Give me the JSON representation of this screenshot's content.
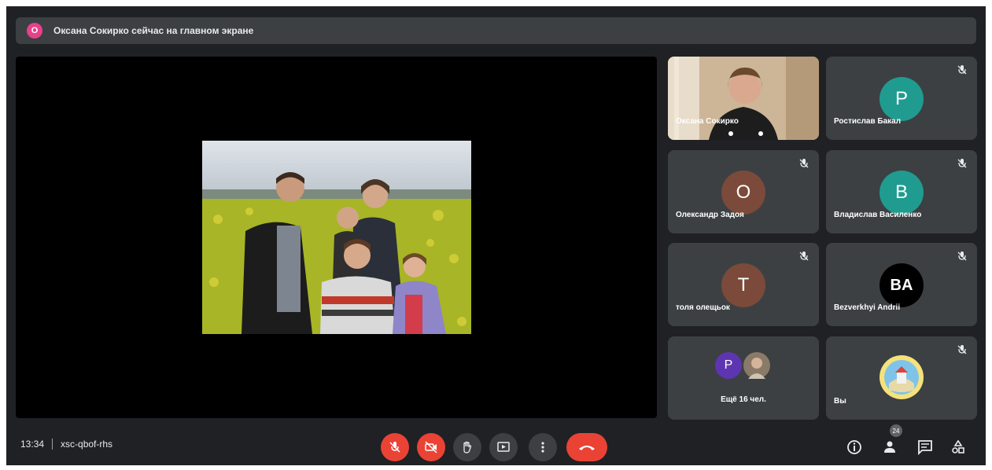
{
  "banner": {
    "avatar_initial": "O",
    "text": "Оксана Сокирко сейчас на главном экране"
  },
  "tiles": [
    {
      "name": "Оксана Сокирко",
      "type": "video"
    },
    {
      "name": "Ростислав Бакал",
      "initial": "P",
      "color": "#1f9c8f"
    },
    {
      "name": "Олександр Задоя",
      "initial": "O",
      "color": "#7b4a3a"
    },
    {
      "name": "Владислав Василенко",
      "initial": "B",
      "color": "#1f9c8f"
    },
    {
      "name": "толя олещьок",
      "initial": "T",
      "color": "#7b4a3a"
    },
    {
      "name": "Bezverkhyi Andrii",
      "initial": "BA",
      "color": "#000000"
    },
    {
      "name": "Ещё 16 чел.",
      "initial": "P",
      "color": "#5e35b1"
    },
    {
      "name": "Вы",
      "type": "self"
    }
  ],
  "bottom_bar": {
    "time": "13:34",
    "meeting_code": "xsc-qbof-rhs",
    "participants_count": "24"
  },
  "colors": {
    "background": "#202124",
    "surface": "#3c4043",
    "danger": "#ea4335"
  },
  "icons": [
    "mic-off-icon",
    "camera-off-icon",
    "hand-icon",
    "present-icon",
    "more-icon",
    "end-call-icon",
    "info-icon",
    "people-icon",
    "chat-icon",
    "activities-icon"
  ]
}
